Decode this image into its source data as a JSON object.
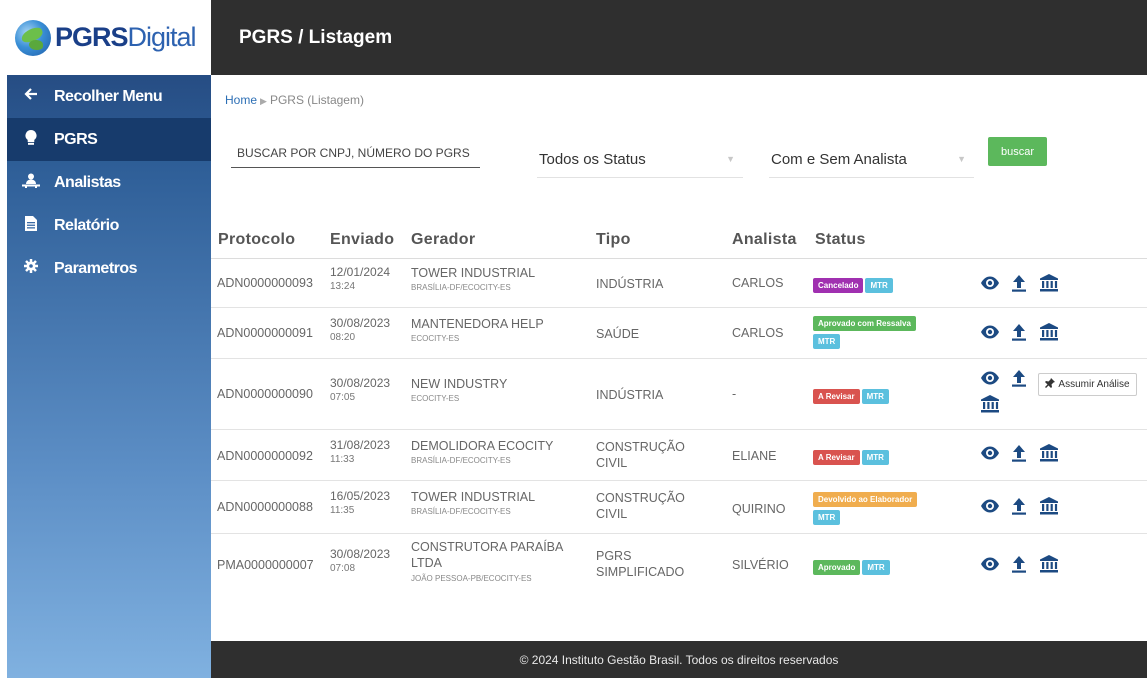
{
  "logo": {
    "text_bold": "PGRS",
    "text_light": "Digital"
  },
  "sidebar": {
    "items": [
      {
        "label": "Recolher Menu",
        "icon": "arrow-left-icon"
      },
      {
        "label": "PGRS",
        "icon": "lightbulb-icon"
      },
      {
        "label": "Analistas",
        "icon": "users-icon"
      },
      {
        "label": "Relatório",
        "icon": "document-icon"
      },
      {
        "label": "Parametros",
        "icon": "gear-icon"
      }
    ],
    "active_index": 1,
    "active_color": "#173b6c"
  },
  "header": {
    "title": "PGRS / Listagem"
  },
  "breadcrumb": {
    "home": "Home",
    "current": "PGRS (Listagem)"
  },
  "filters": {
    "search_placeholder": "BUSCAR POR CNPJ, NÚMERO DO PGRS",
    "status_select": "Todos os Status",
    "analista_select": "Com e Sem Analista",
    "search_button": "buscar"
  },
  "table": {
    "columns": [
      "Protocolo",
      "Enviado",
      "Gerador",
      "Tipo",
      "Analista",
      "Status"
    ],
    "rows": [
      {
        "protocolo": "ADN0000000093",
        "data": "12/01/2024",
        "hora": "13:24",
        "gerador": "TOWER INDUSTRIAL",
        "local": "BRASÍLIA-DF/ECOCITY-ES",
        "tipo": "INDÚSTRIA",
        "analista": "CARLOS",
        "status": "Cancelado",
        "status_color": "purple",
        "mtr": "MTR"
      },
      {
        "protocolo": "ADN0000000091",
        "data": "30/08/2023",
        "hora": "08:20",
        "gerador": "MANTENEDORA HELP",
        "local": "ECOCITY-ES",
        "tipo": "SAÚDE",
        "analista": "CARLOS",
        "status": "Aprovado com Ressalva",
        "status_color": "green",
        "mtr": "MTR"
      },
      {
        "protocolo": "ADN0000000090",
        "data": "30/08/2023",
        "hora": "07:05",
        "gerador": "NEW INDUSTRY",
        "local": "ECOCITY-ES",
        "tipo": "INDÚSTRIA",
        "analista": "-",
        "status": "A Revisar",
        "status_color": "red",
        "mtr": "MTR",
        "assumir": "Assumir Análise"
      },
      {
        "protocolo": "ADN0000000092",
        "data": "31/08/2023",
        "hora": "11:33",
        "gerador": "DEMOLIDORA ECOCITY",
        "local": "BRASÍLIA-DF/ECOCITY-ES",
        "tipo": "CONSTRUÇÃO CIVIL",
        "analista": "ELIANE",
        "status": "A Revisar",
        "status_color": "red",
        "mtr": "MTR"
      },
      {
        "protocolo": "ADN0000000088",
        "data": "16/05/2023",
        "hora": "11:35",
        "gerador": "TOWER INDUSTRIAL",
        "local": "BRASÍLIA-DF/ECOCITY-ES",
        "tipo": "CONSTRUÇÃO CIVIL",
        "analista": "QUIRINO",
        "status": "Devolvido ao Elaborador",
        "status_color": "orange",
        "mtr": "MTR"
      },
      {
        "protocolo": "PMA0000000007",
        "data": "30/08/2023",
        "hora": "07:08",
        "gerador": "CONSTRUTORA PARAÍBA LTDA",
        "local": "JOÃO PESSOA-PB/ECOCITY-ES",
        "tipo": "PGRS SIMPLIFICADO",
        "analista": "SILVÉRIO",
        "status": "Aprovado",
        "status_color": "green",
        "mtr": "MTR"
      }
    ],
    "action_icons": [
      "eye-icon",
      "upload-icon",
      "bank-icon"
    ],
    "action_color": "#1c4a82"
  },
  "footer": {
    "text": "© 2024 Instituto Gestão Brasil. Todos os direitos reservados"
  }
}
